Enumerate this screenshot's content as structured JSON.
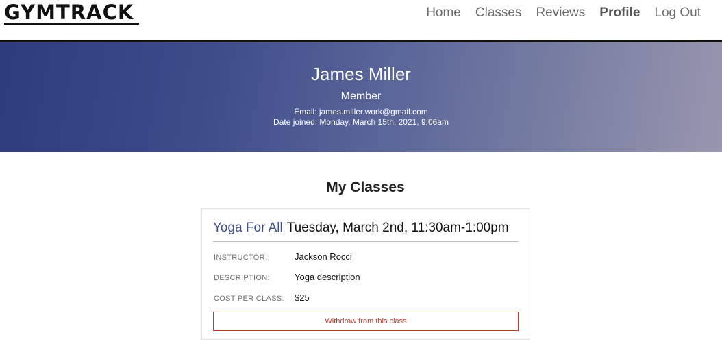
{
  "brand": {
    "name": "GYMTRACK"
  },
  "nav": {
    "items": [
      {
        "label": "Home"
      },
      {
        "label": "Classes"
      },
      {
        "label": "Reviews"
      },
      {
        "label": "Profile",
        "active": true
      },
      {
        "label": "Log Out"
      }
    ]
  },
  "profile": {
    "name": "James Miller",
    "role": "Member",
    "email_line": "Email: james.miller.work@gmail.com",
    "joined_line": "Date joined: Monday, March 15th, 2021, 9:06am"
  },
  "my_classes": {
    "title": "My Classes",
    "classes": [
      {
        "name": "Yoga For All",
        "time": "Tuesday, March 2nd, 11:30am-1:00pm",
        "instructor_label": "INSTRUCTOR:",
        "instructor": "Jackson Rocci",
        "description_label": "DESCRIPTION:",
        "description": "Yoga description",
        "cost_label": "COST PER CLASS:",
        "cost": "$25",
        "withdraw_label": "Withdraw from this class"
      }
    ]
  },
  "colors": {
    "hero_gradient_start": "#2e3b7c",
    "hero_gradient_end": "#9896ae",
    "class_name": "#3d4b86",
    "withdraw": "#c0392b"
  }
}
